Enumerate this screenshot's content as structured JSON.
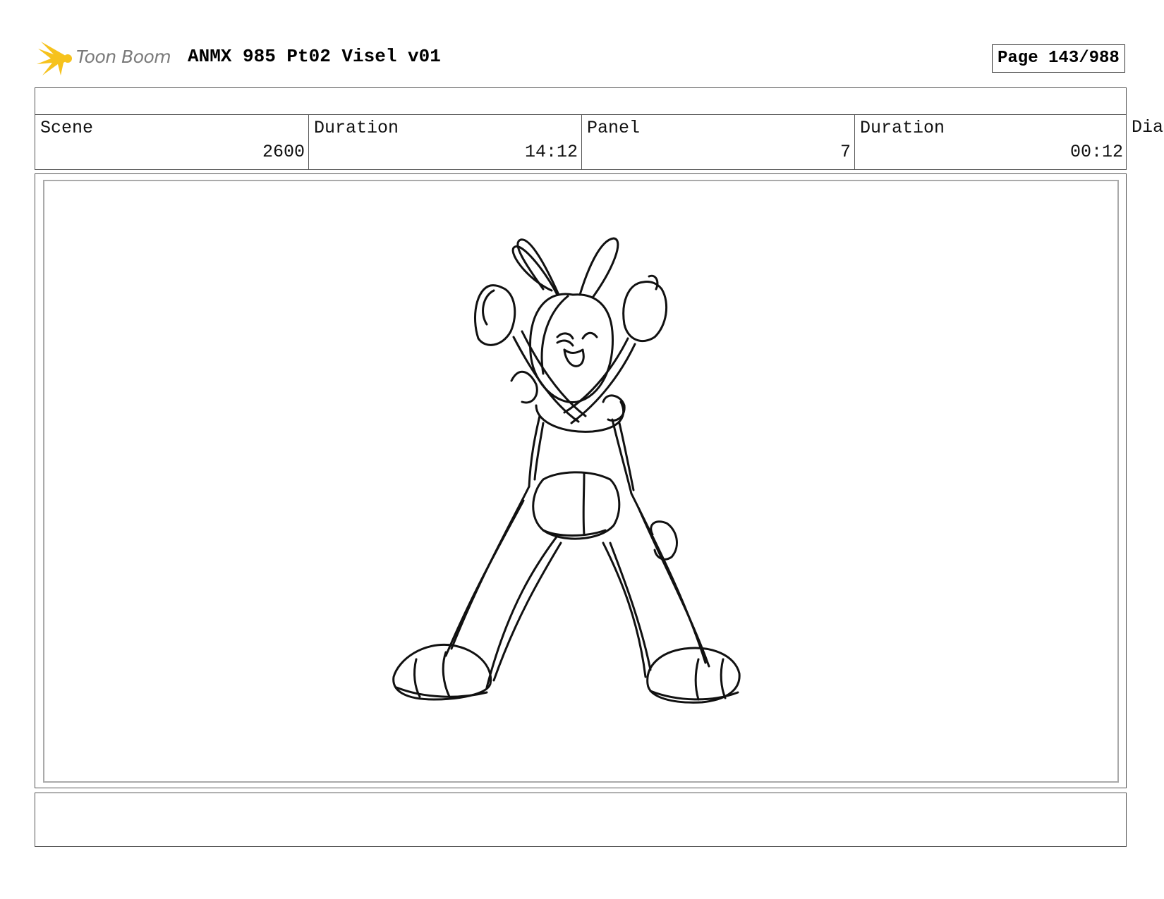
{
  "header": {
    "logo_text": "Toon Boom",
    "title": "ANMX 985 Pt02 Visel v01",
    "page": "Page 143/988"
  },
  "info": {
    "scene_label": "Scene",
    "scene_value": "2600",
    "scene_duration_label": "Duration",
    "scene_duration_value": "14:12",
    "panel_label": "Panel",
    "panel_value": "7",
    "panel_duration_label": "Duration",
    "panel_duration_value": "00:12",
    "dialog_label": "Dia"
  },
  "colors": {
    "logo_yellow": "#f6c21c",
    "logo_text": "#7a7a7a",
    "border": "#555555",
    "inner_border": "#aaaaaa"
  }
}
